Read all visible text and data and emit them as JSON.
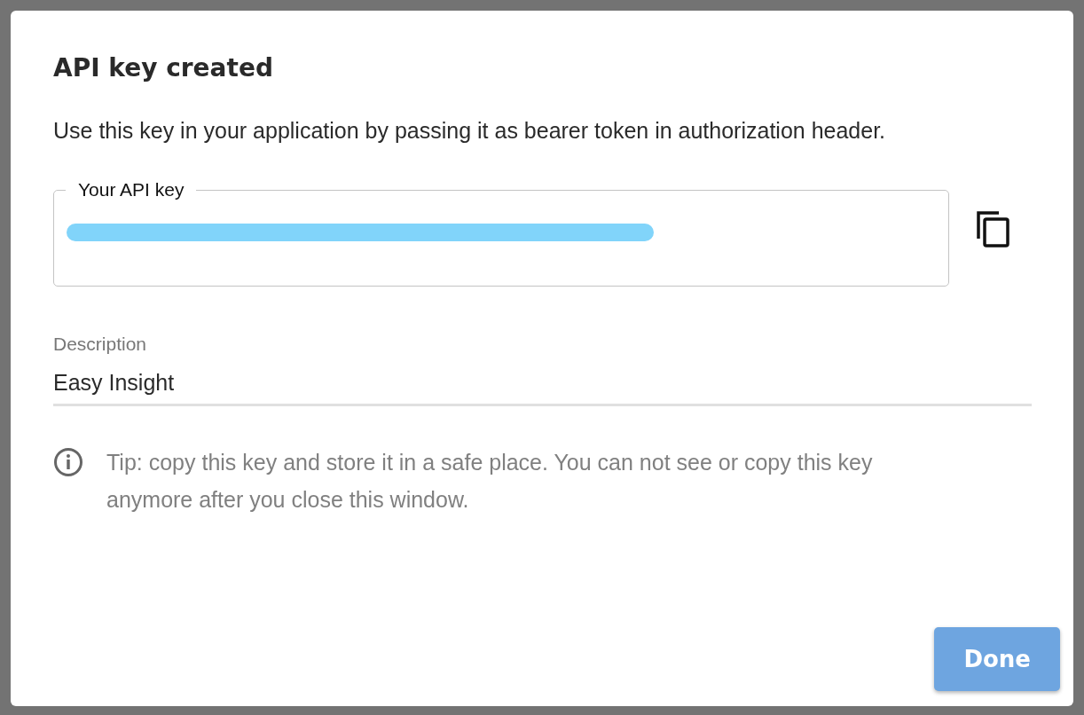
{
  "dialog": {
    "title": "API key created",
    "message": "Use this key in your application by passing it as bearer token in authorization header.",
    "api_key_field": {
      "label": "Your API key"
    },
    "description_field": {
      "label": "Description",
      "value": "Easy Insight"
    },
    "tip": "Tip: copy this key and store it in a safe place. You can not see or copy this key anymore after you close this window.",
    "buttons": [
      {
        "label": "Done",
        "kind": "primary"
      }
    ]
  }
}
